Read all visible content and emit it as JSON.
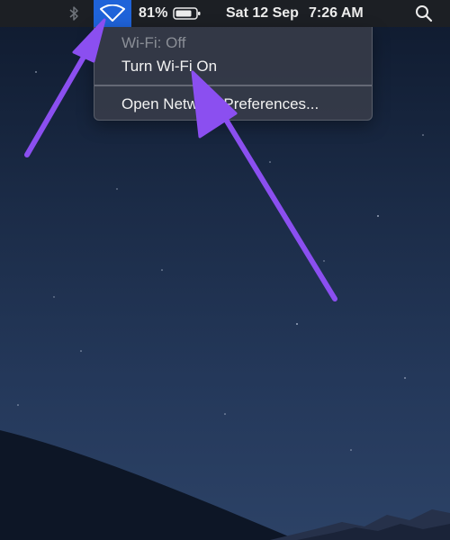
{
  "menubar": {
    "icons": [
      "bluetooth-icon",
      "wifi-icon",
      "battery-icon",
      "search-icon"
    ],
    "battery_percent": "81%",
    "battery_level": 0.81,
    "date": "Sat 12 Sep",
    "time": "7:26 AM"
  },
  "wifi_menu": {
    "status": "Wi-Fi: Off",
    "turn_on": "Turn Wi-Fi On",
    "open_prefs": "Open Network Preferences..."
  },
  "colors": {
    "menubar": "#1c1f24",
    "wifi_highlight": "#1f63d9",
    "arrow": "#8b4ff0",
    "menu_bg": "#3a3e4a"
  }
}
